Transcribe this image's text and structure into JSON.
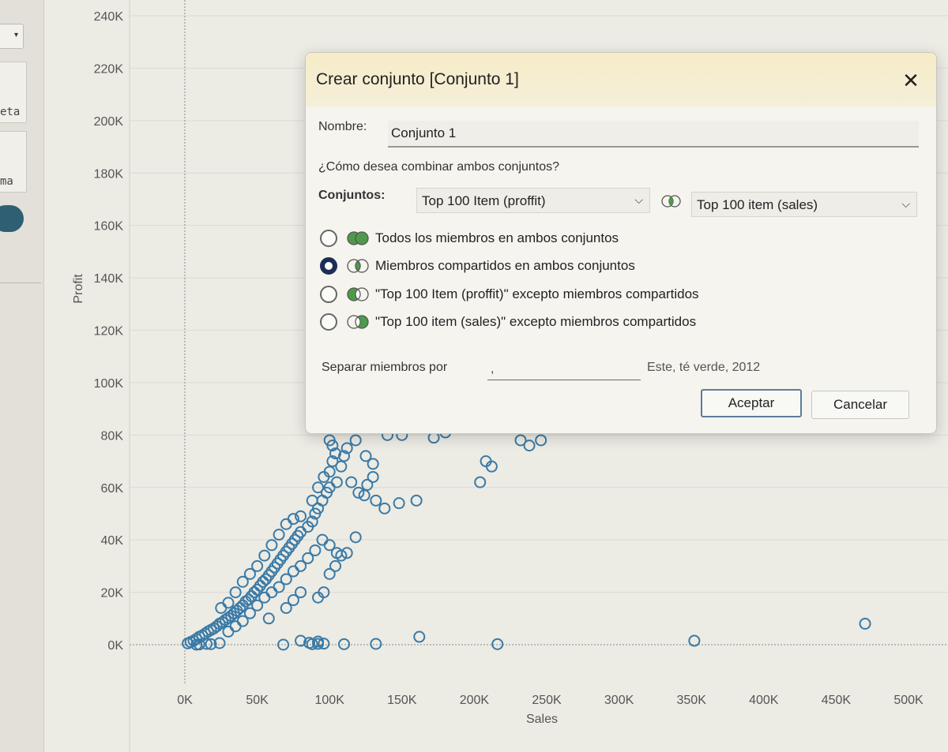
{
  "sidebar": {
    "dropdown_glyph": "▾",
    "text_fragment_1": "eta",
    "text_fragment_2": "ma"
  },
  "chart_data": {
    "type": "scatter",
    "xlabel": "Sales",
    "ylabel": "Profit",
    "xlim": [
      0,
      500000
    ],
    "ylim": [
      0,
      240000
    ],
    "x_ticks": [
      "0K",
      "50K",
      "100K",
      "150K",
      "200K",
      "250K",
      "300K",
      "350K",
      "400K",
      "450K",
      "500K"
    ],
    "y_ticks": [
      "0K",
      "20K",
      "40K",
      "60K",
      "80K",
      "100K",
      "120K",
      "140K",
      "160K",
      "180K",
      "200K",
      "220K",
      "240K"
    ],
    "marker": "hollow-circle",
    "marker_color": "#3a7aa6",
    "grid": true,
    "points": [
      [
        2000,
        500
      ],
      [
        4000,
        1000
      ],
      [
        6000,
        1500
      ],
      [
        8000,
        2200
      ],
      [
        10000,
        3000
      ],
      [
        12000,
        3500
      ],
      [
        14000,
        4200
      ],
      [
        16000,
        5000
      ],
      [
        18000,
        5600
      ],
      [
        20000,
        6200
      ],
      [
        22000,
        7000
      ],
      [
        24000,
        8000
      ],
      [
        26000,
        8600
      ],
      [
        28000,
        9500
      ],
      [
        30000,
        10200
      ],
      [
        32000,
        11000
      ],
      [
        34000,
        12000
      ],
      [
        36000,
        13000
      ],
      [
        38000,
        14000
      ],
      [
        40000,
        15000
      ],
      [
        42000,
        16500
      ],
      [
        44000,
        17200
      ],
      [
        46000,
        18500
      ],
      [
        48000,
        20000
      ],
      [
        50000,
        21000
      ],
      [
        52000,
        22500
      ],
      [
        54000,
        24000
      ],
      [
        56000,
        25000
      ],
      [
        58000,
        26500
      ],
      [
        60000,
        28000
      ],
      [
        62000,
        29500
      ],
      [
        64000,
        31000
      ],
      [
        66000,
        32500
      ],
      [
        68000,
        34000
      ],
      [
        70000,
        35500
      ],
      [
        72000,
        37000
      ],
      [
        74000,
        38500
      ],
      [
        76000,
        40000
      ],
      [
        78000,
        41500
      ],
      [
        80000,
        43000
      ],
      [
        85000,
        45000
      ],
      [
        88000,
        47000
      ],
      [
        90000,
        50000
      ],
      [
        92000,
        52000
      ],
      [
        95000,
        55000
      ],
      [
        98000,
        58000
      ],
      [
        100000,
        60000
      ],
      [
        105000,
        62000
      ],
      [
        30000,
        5000
      ],
      [
        35000,
        7000
      ],
      [
        40000,
        9000
      ],
      [
        45000,
        12000
      ],
      [
        50000,
        15000
      ],
      [
        55000,
        18000
      ],
      [
        60000,
        20000
      ],
      [
        65000,
        22000
      ],
      [
        70000,
        25000
      ],
      [
        75000,
        28000
      ],
      [
        80000,
        30000
      ],
      [
        85000,
        33000
      ],
      [
        90000,
        36000
      ],
      [
        95000,
        40000
      ],
      [
        100000,
        38000
      ],
      [
        105000,
        35000
      ],
      [
        25000,
        14000
      ],
      [
        30000,
        16000
      ],
      [
        35000,
        20000
      ],
      [
        40000,
        24000
      ],
      [
        45000,
        27000
      ],
      [
        50000,
        30000
      ],
      [
        55000,
        34000
      ],
      [
        60000,
        38000
      ],
      [
        65000,
        42000
      ],
      [
        70000,
        46000
      ],
      [
        75000,
        48000
      ],
      [
        80000,
        49000
      ],
      [
        88000,
        55000
      ],
      [
        92000,
        60000
      ],
      [
        96000,
        64000
      ],
      [
        100000,
        66000
      ],
      [
        102000,
        70000
      ],
      [
        108000,
        68000
      ],
      [
        112000,
        75000
      ],
      [
        118000,
        78000
      ],
      [
        125000,
        72000
      ],
      [
        130000,
        69000
      ],
      [
        140000,
        80000
      ],
      [
        150000,
        80000
      ],
      [
        148000,
        54000
      ],
      [
        160000,
        55000
      ],
      [
        138000,
        52000
      ],
      [
        124000,
        57000
      ],
      [
        118000,
        41000
      ],
      [
        130000,
        64000
      ],
      [
        172000,
        79000
      ],
      [
        180000,
        81000
      ],
      [
        212000,
        68000
      ],
      [
        208000,
        70000
      ],
      [
        204000,
        62000
      ],
      [
        232000,
        78000
      ],
      [
        238000,
        76000
      ],
      [
        246000,
        78000
      ],
      [
        100000,
        78000
      ],
      [
        102000,
        76000
      ],
      [
        104000,
        73000
      ],
      [
        110000,
        72000
      ],
      [
        115000,
        62000
      ],
      [
        120000,
        58000
      ],
      [
        126000,
        61000
      ],
      [
        132000,
        55000
      ],
      [
        92000,
        18000
      ],
      [
        96000,
        20000
      ],
      [
        108000,
        34000
      ],
      [
        112000,
        35000
      ],
      [
        104000,
        30000
      ],
      [
        100000,
        27000
      ],
      [
        70000,
        14000
      ],
      [
        75000,
        17000
      ],
      [
        80000,
        20000
      ],
      [
        58000,
        10000
      ],
      [
        24000,
        600
      ],
      [
        68000,
        0
      ],
      [
        80000,
        1500
      ],
      [
        88000,
        200
      ],
      [
        92000,
        300
      ],
      [
        96000,
        400
      ],
      [
        110000,
        200
      ],
      [
        132000,
        300
      ],
      [
        162000,
        3000
      ],
      [
        216000,
        200
      ],
      [
        352000,
        1500
      ],
      [
        470000,
        8000
      ],
      [
        86000,
        700
      ],
      [
        92000,
        1200
      ],
      [
        8000,
        0
      ],
      [
        10000,
        100
      ],
      [
        15000,
        300
      ],
      [
        18000,
        200
      ]
    ]
  },
  "dialog": {
    "title": "Crear conjunto [Conjunto 1]",
    "close_glyph": "✕",
    "name_label": "Nombre:",
    "name_value": "Conjunto 1",
    "question": "¿Cómo desea combinar ambos conjuntos?",
    "sets_label": "Conjuntos:",
    "set1_value": "Top 100 Item (proffit)",
    "set2_value": "Top 100 item (sales)",
    "chevron_glyph": "⌵",
    "options": [
      {
        "label": "Todos los miembros en ambos conjuntos",
        "selected": false,
        "venn": "union"
      },
      {
        "label": "Miembros compartidos en ambos conjuntos",
        "selected": true,
        "venn": "intersection"
      },
      {
        "label": "\"Top 100 Item (proffit)\" excepto miembros compartidos",
        "selected": false,
        "venn": "left-only"
      },
      {
        "label": "\"Top 100 item (sales)\" excepto miembros compartidos",
        "selected": false,
        "venn": "right-only"
      }
    ],
    "separator_label": "Separar miembros por",
    "separator_value": ",",
    "separator_example": "Este, té verde, 2012",
    "accept_label": "Aceptar",
    "cancel_label": "Cancelar",
    "venn_color": "#4e9a4a"
  }
}
